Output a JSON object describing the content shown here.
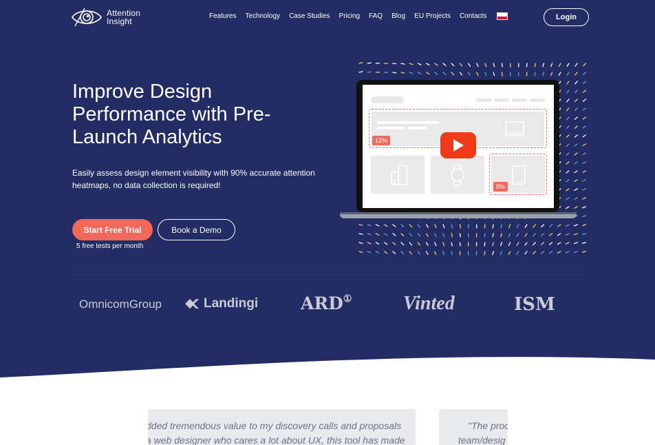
{
  "brand": {
    "line1": "Attention",
    "line2": "Insight",
    "logo_icon": "eye-logo-icon"
  },
  "nav": {
    "items": [
      "Features",
      "Technology",
      "Case Studies",
      "Pricing",
      "FAQ",
      "Blog",
      "EU Projects",
      "Contacts"
    ],
    "language_flag": "poland-flag-icon",
    "login_label": "Login"
  },
  "hero": {
    "headline": "Improve Design Performance with Pre-Launch Analytics",
    "subtext": "Easily assess design element visibility with 90% accurate attention heatmaps, no data collection is required!",
    "primary_cta": "Start Free Trial",
    "secondary_cta": "Book a Demo",
    "cta_note": "5 free tests per month"
  },
  "illustration": {
    "badge_top": "12%",
    "badge_bottom": "8%",
    "play_icon": "youtube-play-icon"
  },
  "clients": [
    "OmnicomGroup",
    "Landingi",
    "ARD",
    "Vinted",
    "ISM"
  ],
  "testimonials": {
    "card1_line1": "dded tremendous value to my discovery calls and proposals",
    "card1_line2": "a web designer who cares a lot about UX, this tool has made",
    "card2_line1": "\"The prod",
    "card2_line2": "team/desig"
  },
  "colors": {
    "hero_bg": "#232c63",
    "accent": "#f2685a",
    "play": "#f03a17"
  }
}
